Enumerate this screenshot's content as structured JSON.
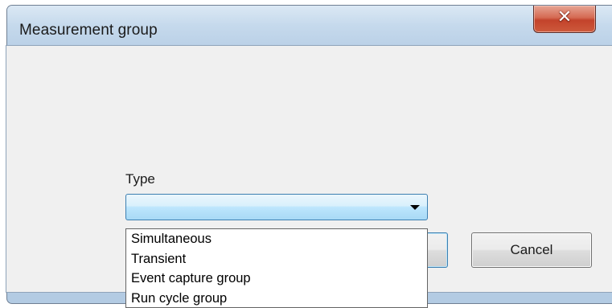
{
  "window": {
    "title": "Measurement group",
    "close_icon": "close-icon"
  },
  "form": {
    "type_label": "Type",
    "type_value": "",
    "ok_label": "",
    "cancel_label": "Cancel"
  },
  "dropdown": {
    "options": [
      "Simultaneous",
      "Transient",
      "Event capture group",
      "Run cycle group"
    ]
  },
  "colors": {
    "close_button": "#c3432b",
    "titlebar": "#c5d9ec",
    "combo_highlight": "#bee6fd"
  }
}
